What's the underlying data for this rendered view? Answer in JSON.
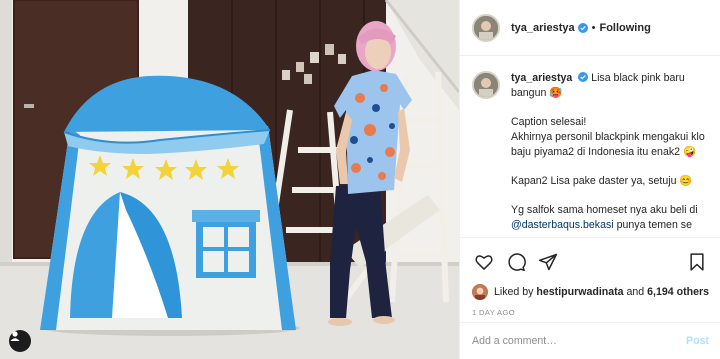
{
  "post": {
    "username": "tya_ariestya",
    "follow_status": "Following",
    "separator": "•"
  },
  "caption": {
    "username": "tya_ariestya",
    "line1": "Lisa black pink baru bangun 🥵",
    "para2_l1": "Caption selesai!",
    "para2_l2": "Akhirnya personil blackpink mengakui klo baju piyama2 di Indonesia itu enak2 🤪",
    "para3": "Kapan2 Lisa pake daster ya, setuju 😊",
    "para4_start": "Yg salfok sama homeset nya aku beli di",
    "mention": "@dasterbaqus.bekasi",
    "para4_end": "punya temen se"
  },
  "likes": {
    "prefix": "Liked by",
    "user": "hestipurwadinata",
    "and": "and",
    "others": "6,194 others"
  },
  "timestamp": "1 DAY AGO",
  "comment_box": {
    "placeholder": "Add a comment…",
    "post_label": "Post"
  },
  "icons": {
    "like": "heart-icon",
    "comment": "comment-bubble-icon",
    "share": "paper-plane-icon",
    "save": "bookmark-icon",
    "user_tag": "person-icon",
    "verified": "verified-badge-icon"
  },
  "colors": {
    "tent_blue": "#3fa0e0",
    "tent_white": "#eef0ee",
    "star": "#f4d23a",
    "pink_hair": "#e9a6c7",
    "link_blue": "#00376b",
    "post_disabled": "#b2dffc",
    "verified": "#3897f0"
  }
}
